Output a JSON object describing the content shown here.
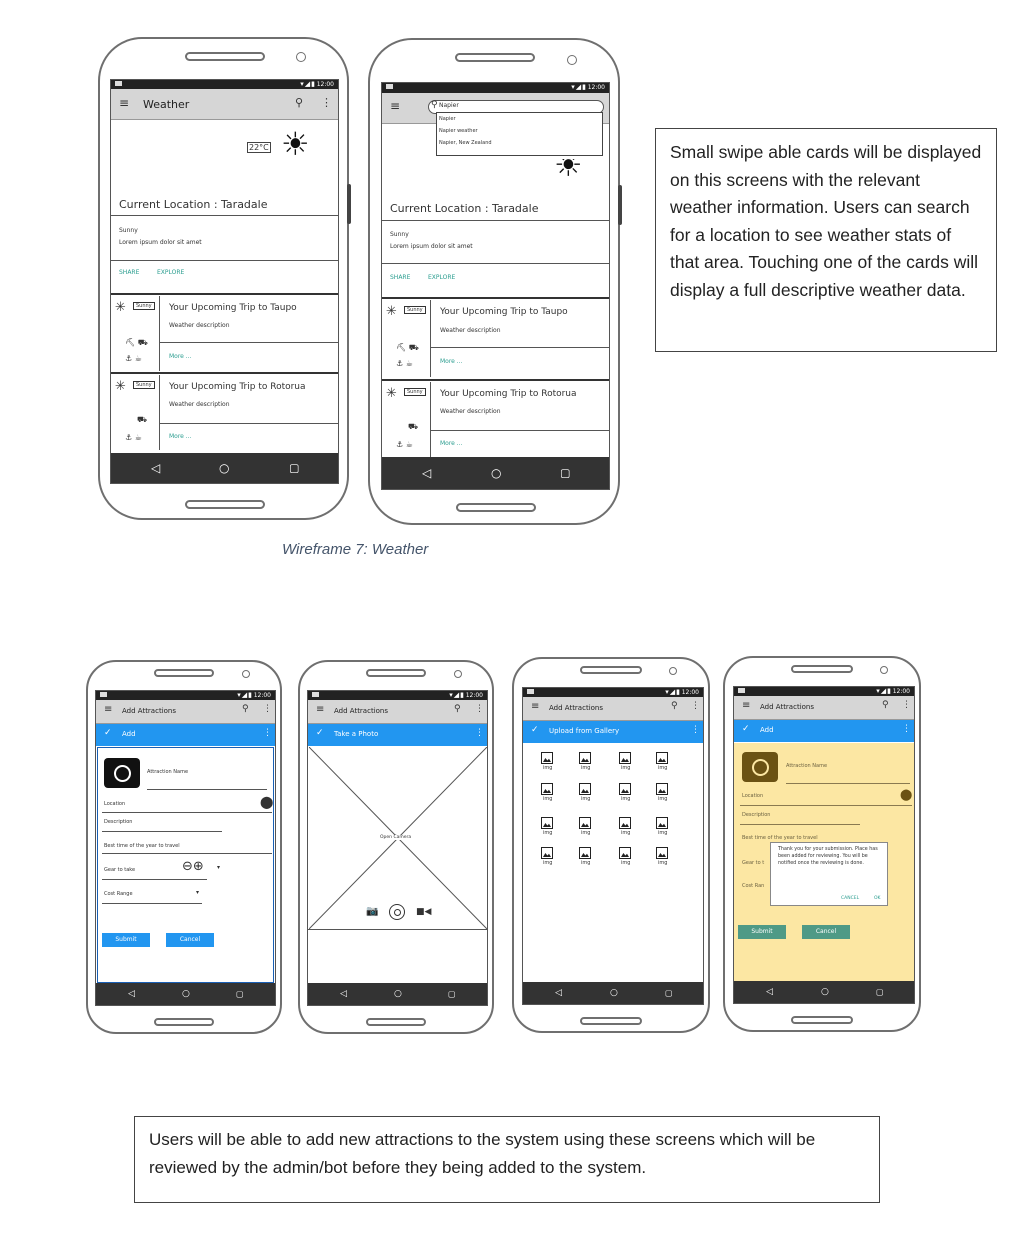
{
  "weather_screen": {
    "status_time": "12:00",
    "app_title": "Weather",
    "temperature": "22°C",
    "location": "Current Location : Taradale",
    "condition": "Sunny",
    "lorem": "Lorem ipsum dolor sit amet",
    "share_label": "SHARE",
    "explore_label": "EXPLORE",
    "cards": [
      {
        "badge": "Sunny",
        "title": "Your Upcoming Trip to Taupo",
        "desc": "Weather description",
        "more": "More ..."
      },
      {
        "badge": "Sunny",
        "title": "Your Upcoming Trip to Rotorua",
        "desc": "Weather description",
        "more": "More ..."
      }
    ]
  },
  "weather_search_screen": {
    "search_value": "Napier",
    "suggestions": [
      "Napier",
      "Napier weather",
      "Napier, New Zealand"
    ]
  },
  "nav_icons": [
    "back-icon",
    "home-icon",
    "recents-icon"
  ],
  "weather_note": "Small swipe able cards will be displayed on this screens with the relevant weather information. Users can search for a location to see weather stats of that area. Touching one of the cards will display a full descriptive weather data.",
  "caption": "Wireframe 7: Weather",
  "attractions": {
    "app_title": "Add Attractions",
    "add_label": "Add",
    "photo_label": "Take a Photo",
    "gallery_label": "Upload from Gallery",
    "attraction_name": "Attraction Name",
    "location": "Location",
    "description": "Description",
    "best_time": "Best time of the year to travel",
    "gear": "Gear to take",
    "cost_range": "Cost Range",
    "submit": "Submit",
    "cancel": "Cancel",
    "open_camera": "Open Camera",
    "img_label": "img",
    "gear_short": "Gear to t",
    "cost_short": "Cost Ran",
    "best_short": "Best time of the year to travel",
    "dialog_text": "Thank you for your submission. Place has been added for reviewing. You will be notified once the reviewing is done.",
    "dialog_cancel": "CANCEL",
    "dialog_ok": "OK"
  },
  "attractions_note": "Users will be able to add new attractions to the system using these screens which will be reviewed by the admin/bot before they being added to the system.",
  "colors": {
    "accent_blue": "#2296f0",
    "dialog_yellow": "#fce7a3",
    "submit_green": "#4f9a86"
  }
}
